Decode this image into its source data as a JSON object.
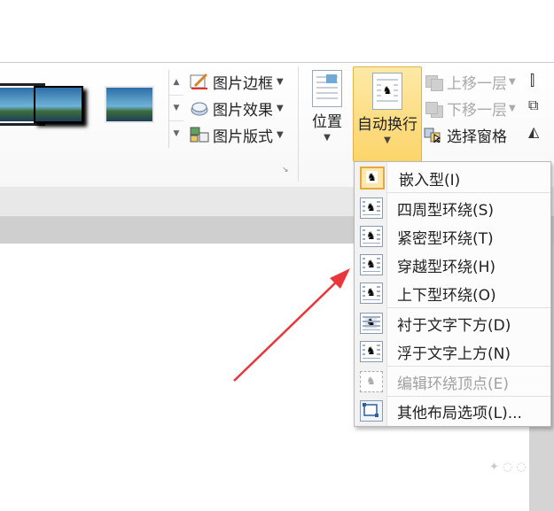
{
  "picture_styles": {
    "commands": [
      {
        "label": "图片边框",
        "icon": "pencil-border-icon"
      },
      {
        "label": "图片效果",
        "icon": "picture-effects-icon"
      },
      {
        "label": "图片版式",
        "icon": "picture-layout-icon"
      }
    ]
  },
  "arrange": {
    "position_label": "位置",
    "wrap_label": "自动换行",
    "commands": [
      {
        "label": "上移一层",
        "disabled": true
      },
      {
        "label": "下移一层",
        "disabled": true
      },
      {
        "label": "选择窗格",
        "disabled": false
      }
    ]
  },
  "wrap_menu": {
    "items": [
      {
        "label": "嵌入型(I)",
        "icon": "inline-wrap-icon",
        "disabled": false
      },
      {
        "label": "四周型环绕(S)",
        "icon": "square-wrap-icon",
        "disabled": false
      },
      {
        "label": "紧密型环绕(T)",
        "icon": "tight-wrap-icon",
        "disabled": false
      },
      {
        "label": "穿越型环绕(H)",
        "icon": "through-wrap-icon",
        "disabled": false
      },
      {
        "label": "上下型环绕(O)",
        "icon": "top-bottom-wrap-icon",
        "disabled": false
      },
      {
        "label": "衬于文字下方(D)",
        "icon": "behind-text-icon",
        "disabled": false
      },
      {
        "label": "浮于文字上方(N)",
        "icon": "in-front-of-text-icon",
        "disabled": false
      },
      {
        "label": "编辑环绕顶点(E)",
        "icon": "edit-wrap-points-icon",
        "disabled": true
      },
      {
        "label": "其他布局选项(L)...",
        "icon": "more-layout-options-icon",
        "disabled": false
      }
    ]
  },
  "colors": {
    "accent_highlight": "#fcd46a",
    "arrow": "#e8363a"
  }
}
